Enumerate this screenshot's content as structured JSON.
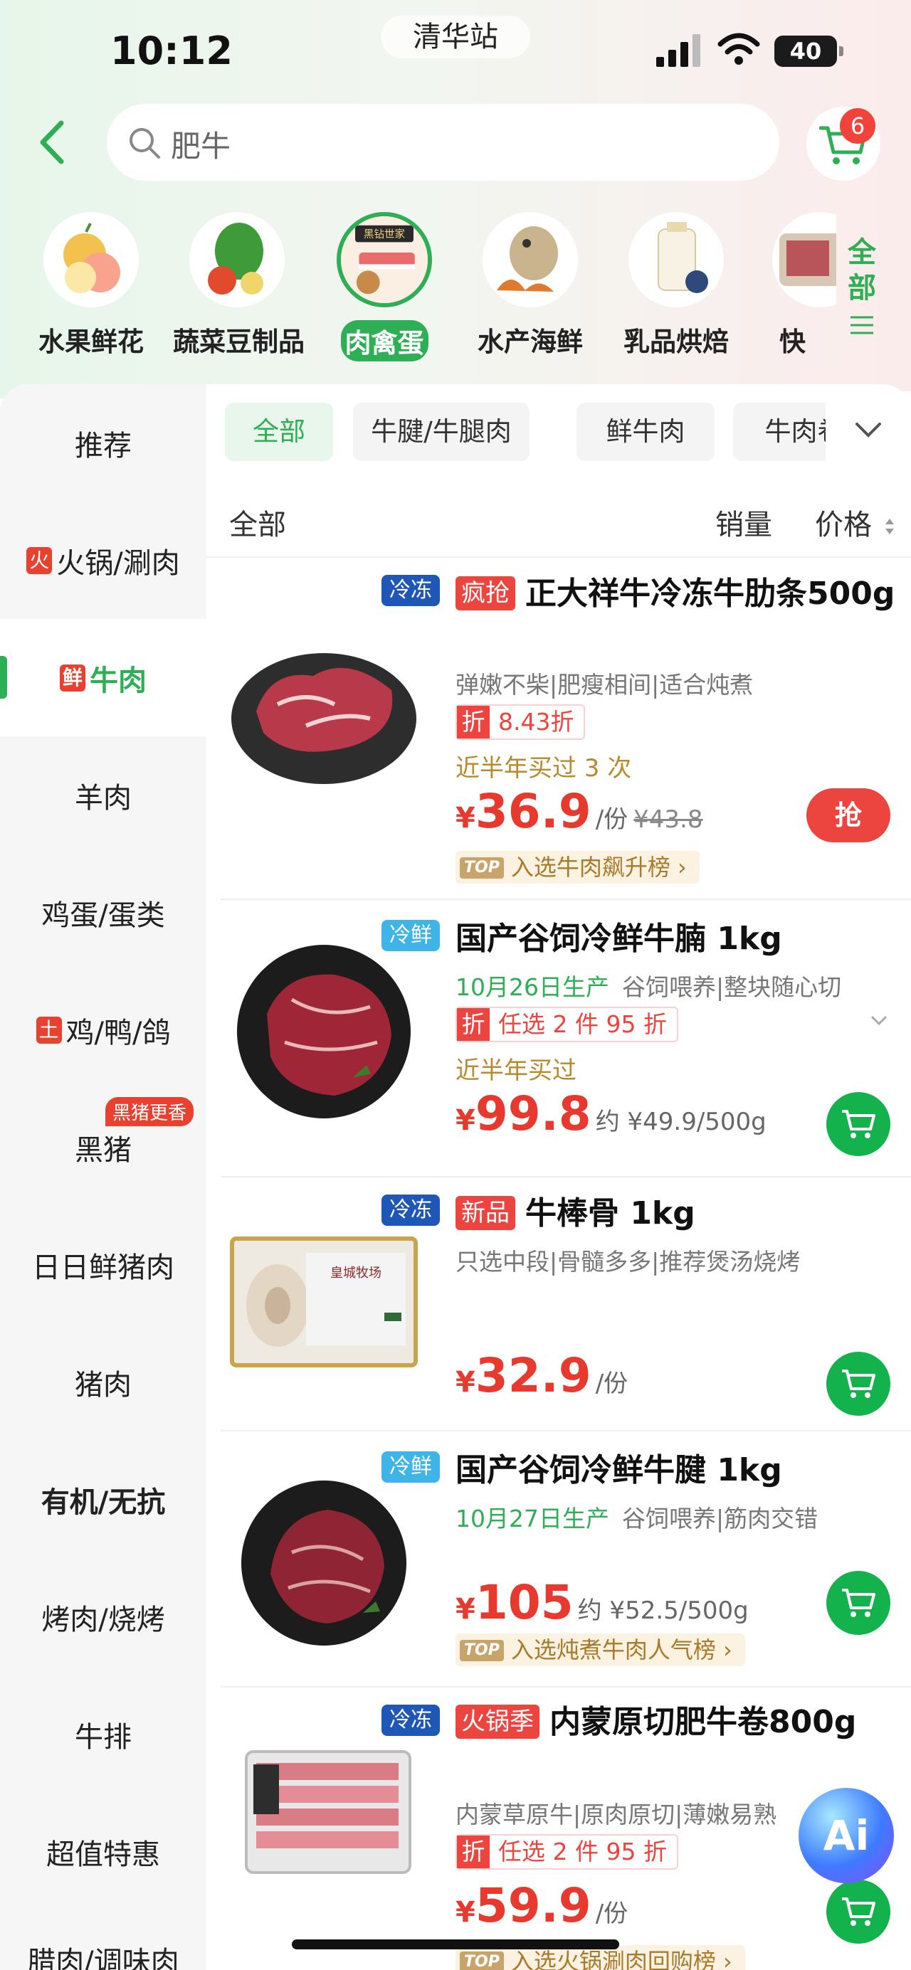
{
  "status_bar": {
    "time": "10:12",
    "station": "清华站",
    "battery": "40"
  },
  "search": {
    "query": "肥牛",
    "cart_count": "6"
  },
  "categories": [
    {
      "label": "水果鲜花",
      "active": false
    },
    {
      "label": "蔬菜豆制品",
      "active": false
    },
    {
      "label": "肉禽蛋",
      "active": true
    },
    {
      "label": "水产海鲜",
      "active": false
    },
    {
      "label": "乳品烘焙",
      "active": false
    },
    {
      "label": "快",
      "active": false
    }
  ],
  "category_banner_text": "黑钻世家",
  "all_categories_label": "全部",
  "sidebar": {
    "items": [
      {
        "label": "推荐"
      },
      {
        "label": "火锅/涮肉",
        "tag": "火"
      },
      {
        "label": "牛肉",
        "tag": "鲜",
        "active": true
      },
      {
        "label": "羊肉"
      },
      {
        "label": "鸡蛋/蛋类"
      },
      {
        "label": "鸡/鸭/鸽",
        "tag": "土"
      },
      {
        "label": "黑猪",
        "badge": "黑猪更香"
      },
      {
        "label": "日日鲜猪肉"
      },
      {
        "label": "猪肉"
      },
      {
        "label": "有机/无抗"
      },
      {
        "label": "烤肉/烧烤"
      },
      {
        "label": "牛排"
      },
      {
        "label": "超值特惠"
      },
      {
        "label": "腊肉/调味肉"
      }
    ]
  },
  "filters": [
    "全部",
    "牛腱/牛腿肉",
    "鲜牛肉",
    "牛肉卷"
  ],
  "sort": {
    "all": "全部",
    "sales": "销量",
    "price": "价格"
  },
  "products": [
    {
      "storage": "冷冻",
      "promo_tag": "疯抢",
      "title": "正大祥牛冷冻牛肋条500g",
      "desc": "弹嫩不柴|肥瘦相间|适合炖煮",
      "discount_label": "折",
      "discount": "8.43折",
      "sold": "近半年买过 3 次",
      "currency": "¥",
      "price": "36.9",
      "unit": "/份",
      "orig_price": "¥43.8",
      "rank": "入选牛肉飙升榜 ›",
      "button": "抢"
    },
    {
      "storage": "冷鲜",
      "title": "国产谷饲冷鲜牛腩 1kg",
      "date": "10月26日生产",
      "desc": "谷饲喂养|整块随心切",
      "discount_label": "折",
      "discount": "任选 2 件 95 折",
      "sold": "近半年买过",
      "currency": "¥",
      "price": "99.8",
      "unit": "约 ¥49.9/500g"
    },
    {
      "storage": "冷冻",
      "promo_tag": "新品",
      "title": "牛棒骨 1kg",
      "desc": "只选中段|骨髓多多|推荐煲汤烧烤",
      "currency": "¥",
      "price": "32.9",
      "unit": "/份",
      "package_label": "皇城牧场"
    },
    {
      "storage": "冷鲜",
      "title": "国产谷饲冷鲜牛腱 1kg",
      "date": "10月27日生产",
      "desc": "谷饲喂养|筋肉交错",
      "currency": "¥",
      "price": "105",
      "unit": "约 ¥52.5/500g",
      "rank": "入选炖煮牛肉人气榜 ›"
    },
    {
      "storage": "冷冻",
      "promo_tag": "火锅季",
      "title": "内蒙原切肥牛卷800g",
      "desc": "内蒙草原牛|原肉原切|薄嫩易熟",
      "discount_label": "折",
      "discount": "任选 2 件 95 折",
      "currency": "¥",
      "price": "59.9",
      "unit": "/份",
      "rank": "入选火锅涮肉回购榜 ›"
    }
  ],
  "ai_button": "Ai",
  "rank_badge": "TOP",
  "colors": {
    "accent_green": "#2eae55",
    "price_red": "#e8392f",
    "frozen_blue": "#1f57b7",
    "fresh_blue": "#3fb4e7"
  }
}
